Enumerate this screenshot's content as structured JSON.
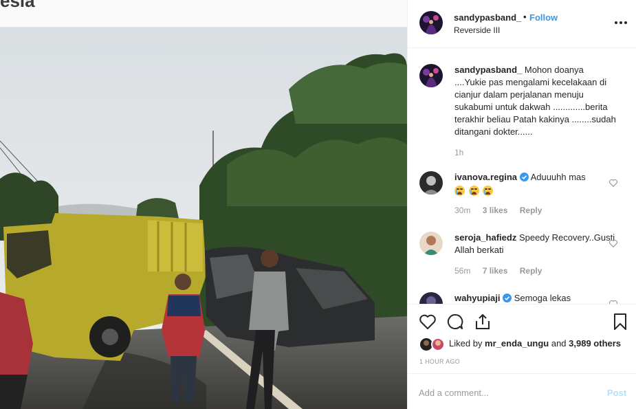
{
  "headline": "esia",
  "photo": {
    "description_icon": "accident-photo"
  },
  "header": {
    "username": "sandypasband_",
    "separator": "•",
    "follow_label": "Follow",
    "location": "Reverside III",
    "more_icon": "more-dots-icon"
  },
  "comments": [
    {
      "username": "sandypasband_",
      "text": " Mohon doanya ....Yukie pas mengalami kecelakaan di cianjur dalam perjalanan menuju sukabumi untuk dakwah .............berita terakhir beliau Patah kakinya ........sudah ditangani dokter......",
      "time": "1h"
    },
    {
      "username": "ivanova.regina",
      "verified": true,
      "text": " Aduuuhh mas",
      "time": "30m",
      "likes": "3 likes",
      "reply": "Reply"
    },
    {
      "username": "seroja_hafiedz",
      "text": " Speedy Recovery..Gusti Allah berkati",
      "time": "56m",
      "likes": "7 likes",
      "reply": "Reply"
    },
    {
      "username": "wahyupiaji",
      "verified": true,
      "text": " Semoga lekas"
    }
  ],
  "actions": {
    "liked_by_prefix": "Liked by ",
    "liked_by_user": "mr_enda_ungu",
    "liked_by_and": " and ",
    "liked_by_count": "3,989 others",
    "time_ago": "1 HOUR AGO"
  },
  "add_comment": {
    "placeholder": "Add a comment...",
    "post_label": "Post"
  },
  "colors": {
    "link_blue": "#3897f0",
    "post_disabled": "#b2dffc",
    "verified_blue": "#3897f0"
  }
}
